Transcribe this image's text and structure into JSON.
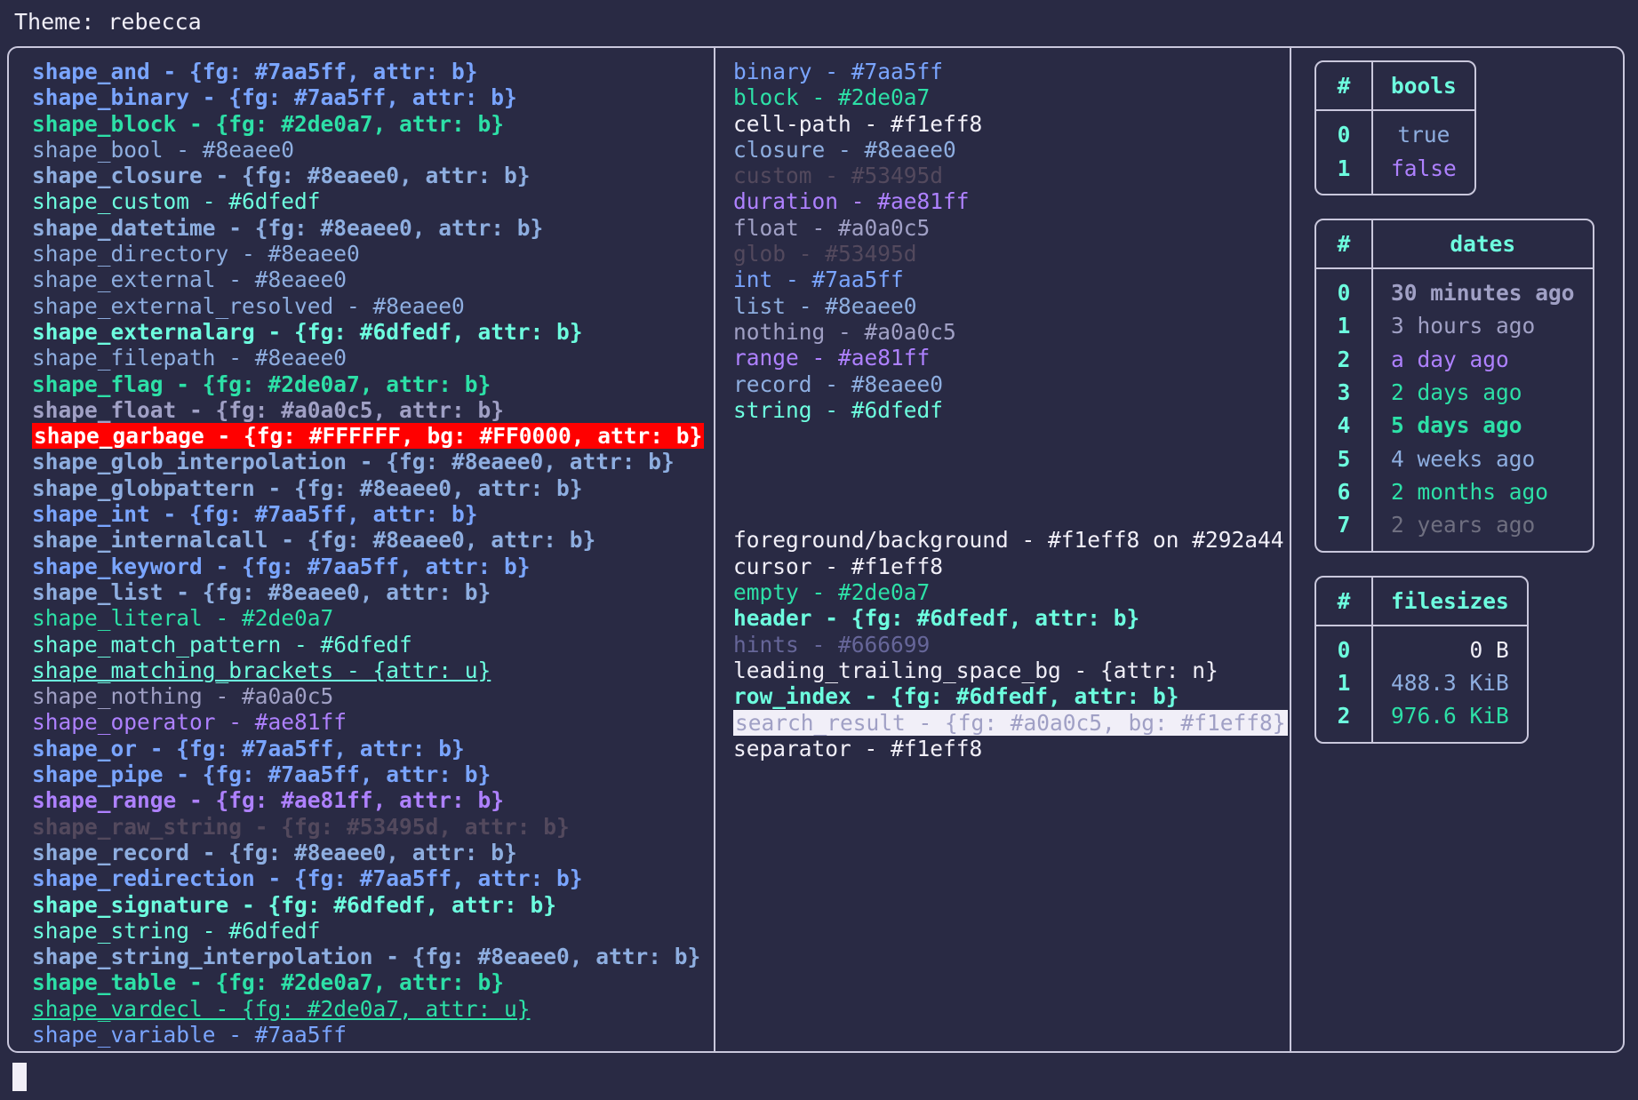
{
  "header": {
    "title": "Theme: rebecca"
  },
  "colors": {
    "background": "#292a44",
    "foreground": "#f1eff8",
    "border": "#c9c7dc",
    "blue": "#7aa5ff",
    "light_blue": "#8eaee0",
    "green": "#2de0a7",
    "teal": "#6dfedf",
    "purple": "#ae81ff",
    "gray": "#a0a0c5",
    "dim": "#53495d",
    "hint": "#666699",
    "garbage_fg": "#FFFFFF",
    "garbage_bg": "#FF0000",
    "search_fg": "#a0a0c5",
    "search_bg": "#f1eff8"
  },
  "shapes": [
    {
      "text": "shape_and - {fg: #7aa5ff, attr: b}",
      "color": "#7aa5ff",
      "bold": true
    },
    {
      "text": "shape_binary - {fg: #7aa5ff, attr: b}",
      "color": "#7aa5ff",
      "bold": true
    },
    {
      "text": "shape_block - {fg: #2de0a7, attr: b}",
      "color": "#2de0a7",
      "bold": true
    },
    {
      "text": "shape_bool - #8eaee0",
      "color": "#8eaee0",
      "bold": false
    },
    {
      "text": "shape_closure - {fg: #8eaee0, attr: b}",
      "color": "#8eaee0",
      "bold": true
    },
    {
      "text": "shape_custom - #6dfedf",
      "color": "#6dfedf",
      "bold": false
    },
    {
      "text": "shape_datetime - {fg: #8eaee0, attr: b}",
      "color": "#8eaee0",
      "bold": true
    },
    {
      "text": "shape_directory - #8eaee0",
      "color": "#8eaee0",
      "bold": false
    },
    {
      "text": "shape_external - #8eaee0",
      "color": "#8eaee0",
      "bold": false
    },
    {
      "text": "shape_external_resolved - #8eaee0",
      "color": "#8eaee0",
      "bold": false
    },
    {
      "text": "shape_externalarg - {fg: #6dfedf, attr: b}",
      "color": "#6dfedf",
      "bold": true
    },
    {
      "text": "shape_filepath - #8eaee0",
      "color": "#8eaee0",
      "bold": false
    },
    {
      "text": "shape_flag - {fg: #2de0a7, attr: b}",
      "color": "#2de0a7",
      "bold": true
    },
    {
      "text": "shape_float - {fg: #a0a0c5, attr: b}",
      "color": "#a0a0c5",
      "bold": true
    },
    {
      "text": "shape_garbage - {fg: #FFFFFF, bg: #FF0000, attr: b}",
      "color": "#FFFFFF",
      "bg": "#FF0000",
      "bold": true
    },
    {
      "text": "shape_glob_interpolation - {fg: #8eaee0, attr: b}",
      "color": "#8eaee0",
      "bold": true
    },
    {
      "text": "shape_globpattern - {fg: #8eaee0, attr: b}",
      "color": "#8eaee0",
      "bold": true
    },
    {
      "text": "shape_int - {fg: #7aa5ff, attr: b}",
      "color": "#7aa5ff",
      "bold": true
    },
    {
      "text": "shape_internalcall - {fg: #8eaee0, attr: b}",
      "color": "#8eaee0",
      "bold": true
    },
    {
      "text": "shape_keyword - {fg: #7aa5ff, attr: b}",
      "color": "#7aa5ff",
      "bold": true
    },
    {
      "text": "shape_list - {fg: #8eaee0, attr: b}",
      "color": "#8eaee0",
      "bold": true
    },
    {
      "text": "shape_literal - #2de0a7",
      "color": "#2de0a7",
      "bold": false
    },
    {
      "text": "shape_match_pattern - #6dfedf",
      "color": "#6dfedf",
      "bold": false
    },
    {
      "text": "shape_matching_brackets - {attr: u}",
      "color": "#6dfedf",
      "bold": false,
      "underline": true
    },
    {
      "text": "shape_nothing - #a0a0c5",
      "color": "#a0a0c5",
      "bold": false
    },
    {
      "text": "shape_operator - #ae81ff",
      "color": "#ae81ff",
      "bold": false
    },
    {
      "text": "shape_or - {fg: #7aa5ff, attr: b}",
      "color": "#7aa5ff",
      "bold": true
    },
    {
      "text": "shape_pipe - {fg: #7aa5ff, attr: b}",
      "color": "#7aa5ff",
      "bold": true
    },
    {
      "text": "shape_range - {fg: #ae81ff, attr: b}",
      "color": "#ae81ff",
      "bold": true
    },
    {
      "text": "shape_raw_string - {fg: #53495d, attr: b}",
      "color": "#53495d",
      "bold": true
    },
    {
      "text": "shape_record - {fg: #8eaee0, attr: b}",
      "color": "#8eaee0",
      "bold": true
    },
    {
      "text": "shape_redirection - {fg: #7aa5ff, attr: b}",
      "color": "#7aa5ff",
      "bold": true
    },
    {
      "text": "shape_signature - {fg: #6dfedf, attr: b}",
      "color": "#6dfedf",
      "bold": true
    },
    {
      "text": "shape_string - #6dfedf",
      "color": "#6dfedf",
      "bold": false
    },
    {
      "text": "shape_string_interpolation - {fg: #8eaee0, attr: b}",
      "color": "#8eaee0",
      "bold": true
    },
    {
      "text": "shape_table - {fg: #2de0a7, attr: b}",
      "color": "#2de0a7",
      "bold": true
    },
    {
      "text": "shape_vardecl - {fg: #2de0a7, attr: u}",
      "color": "#2de0a7",
      "bold": false,
      "underline": true
    },
    {
      "text": "shape_variable - #7aa5ff",
      "color": "#7aa5ff",
      "bold": false
    }
  ],
  "types": [
    {
      "text": "binary - #7aa5ff",
      "color": "#7aa5ff",
      "bold": false
    },
    {
      "text": "block - #2de0a7",
      "color": "#2de0a7",
      "bold": false
    },
    {
      "text": "cell-path - #f1eff8",
      "color": "#f1eff8",
      "bold": false
    },
    {
      "text": "closure - #8eaee0",
      "color": "#8eaee0",
      "bold": false
    },
    {
      "text": "custom - #53495d",
      "color": "#53495d",
      "bold": false
    },
    {
      "text": "duration - #ae81ff",
      "color": "#ae81ff",
      "bold": false
    },
    {
      "text": "float - #a0a0c5",
      "color": "#a0a0c5",
      "bold": false
    },
    {
      "text": "glob - #53495d",
      "color": "#53495d",
      "bold": false
    },
    {
      "text": "int - #7aa5ff",
      "color": "#7aa5ff",
      "bold": false
    },
    {
      "text": "list - #8eaee0",
      "color": "#8eaee0",
      "bold": false
    },
    {
      "text": "nothing - #a0a0c5",
      "color": "#a0a0c5",
      "bold": false
    },
    {
      "text": "range - #ae81ff",
      "color": "#ae81ff",
      "bold": false
    },
    {
      "text": "record - #8eaee0",
      "color": "#8eaee0",
      "bold": false
    },
    {
      "text": "string - #6dfedf",
      "color": "#6dfedf",
      "bold": false
    }
  ],
  "ui_elements": [
    {
      "text": "foreground/background - #f1eff8 on #292a44",
      "color": "#f1eff8",
      "bold": false
    },
    {
      "text": "cursor - #f1eff8",
      "color": "#f1eff8",
      "bold": false
    },
    {
      "text": "empty - #2de0a7",
      "color": "#2de0a7",
      "bold": false
    },
    {
      "text": "header - {fg: #6dfedf, attr: b}",
      "color": "#6dfedf",
      "bold": true
    },
    {
      "text": "hints - #666699",
      "color": "#666699",
      "bold": false
    },
    {
      "text": "leading_trailing_space_bg - {attr: n}",
      "color": "#f1eff8",
      "bold": false
    },
    {
      "text": "row_index - {fg: #6dfedf, attr: b}",
      "color": "#6dfedf",
      "bold": true
    },
    {
      "text": "search_result - {fg: #a0a0c5, bg: #f1eff8}",
      "color": "#a0a0c5",
      "bg": "#f1eff8",
      "bold": false
    },
    {
      "text": "separator - #f1eff8",
      "color": "#f1eff8",
      "bold": false
    }
  ],
  "tables": [
    {
      "name": "bools",
      "index_header": "#",
      "value_header": "bools",
      "align": "center",
      "rows": [
        {
          "index": "0",
          "value": "true",
          "color": "#8eaee0",
          "bold": false
        },
        {
          "index": "1",
          "value": "false",
          "color": "#ae81ff",
          "bold": false
        }
      ]
    },
    {
      "name": "dates",
      "index_header": "#",
      "value_header": "dates",
      "align": "left",
      "rows": [
        {
          "index": "0",
          "value": "30 minutes ago",
          "color": "#a0a0c5",
          "bold": true
        },
        {
          "index": "1",
          "value": "3 hours ago",
          "color": "#a0a0c5",
          "bold": false
        },
        {
          "index": "2",
          "value": "a day ago",
          "color": "#ae81ff",
          "bold": false
        },
        {
          "index": "3",
          "value": "2 days ago",
          "color": "#2de0a7",
          "bold": false
        },
        {
          "index": "4",
          "value": "5 days ago",
          "color": "#2de0a7",
          "bold": true
        },
        {
          "index": "5",
          "value": "4 weeks ago",
          "color": "#8eaee0",
          "bold": false
        },
        {
          "index": "6",
          "value": "2 months ago",
          "color": "#2de0a7",
          "bold": false
        },
        {
          "index": "7",
          "value": "2 years ago",
          "color": "#6f6f80",
          "bold": false
        }
      ]
    },
    {
      "name": "filesizes",
      "index_header": "#",
      "value_header": "filesizes",
      "align": "right",
      "rows": [
        {
          "index": "0",
          "value": "0 B",
          "color": "#f1eff8",
          "bold": false
        },
        {
          "index": "1",
          "value": "488.3 KiB",
          "color": "#8eaee0",
          "bold": false
        },
        {
          "index": "2",
          "value": "976.6 KiB",
          "color": "#2de0a7",
          "bold": false
        }
      ]
    }
  ]
}
